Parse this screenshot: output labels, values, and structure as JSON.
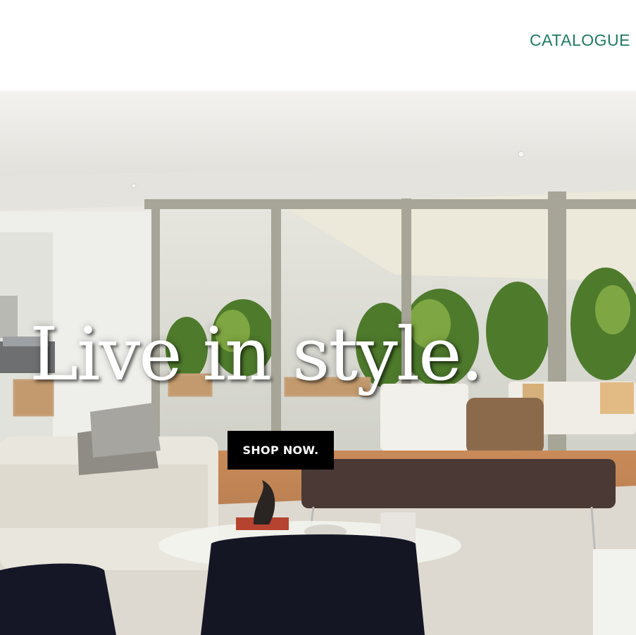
{
  "nav": {
    "catalogue_label": "CATALOGUE"
  },
  "hero": {
    "headline": "Live in style.",
    "cta_label": "SHOP NOW.",
    "image_subject": "modern living room with sofa, coffee table, bench, glass doors to a patio with plants"
  },
  "colors": {
    "nav_link": "#1f7a68",
    "cta_background": "#000000",
    "cta_text": "#ffffff",
    "headline": "#ffffff"
  }
}
